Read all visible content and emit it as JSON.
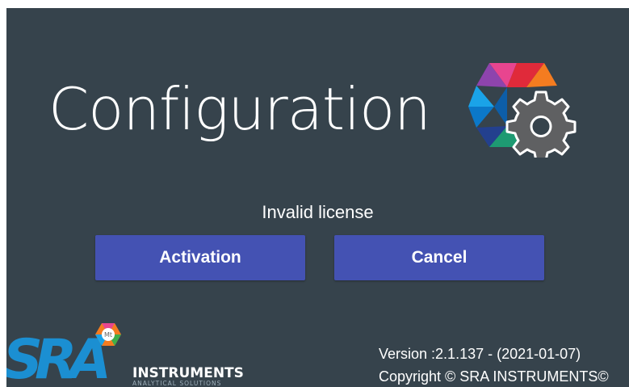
{
  "app": {
    "title": "Configuration",
    "status": "Invalid license"
  },
  "buttons": {
    "activation": "Activation",
    "cancel": "Cancel"
  },
  "brand": {
    "logo_initials": "SRA",
    "company": "INSTRUMENTS",
    "tagline": "ANALYTICAL SOLUTIONS",
    "badge_text": "Mt"
  },
  "footer": {
    "version": "Version :2.1.137 - (2021-01-07)",
    "copyright": "Copyright © SRA INSTRUMENTS©"
  },
  "colors": {
    "background": "#36434c",
    "button": "#4452b3",
    "sra_blue": "#1b8fd2",
    "gear_gray": "#5f6062"
  }
}
